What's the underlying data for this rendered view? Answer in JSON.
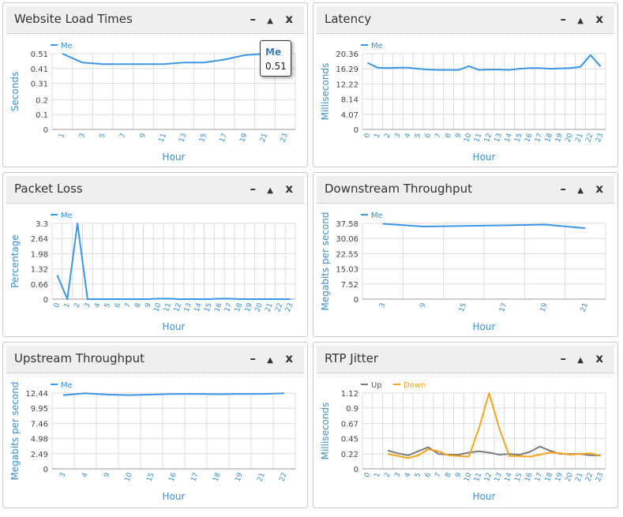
{
  "controls": {
    "minimize": "–",
    "maximize": "▲",
    "close": "x"
  },
  "colors": {
    "line": "#3c96e6",
    "text": "#3c8fcf",
    "grid": "#dcdcdc",
    "up": "#7c7c7c",
    "down": "#f5a41c"
  },
  "tooltip": {
    "series": "Me",
    "value": "0.51"
  },
  "chart_data": [
    {
      "type": "line",
      "title": "Website Load Times",
      "xlabel": "Hour",
      "ylabel": "Seconds",
      "legend": "top-left",
      "yticks": [
        "0.51",
        "0.41",
        "0.31",
        "0.2",
        "0.1",
        "0"
      ],
      "ylim": [
        0,
        0.51
      ],
      "xcats": [
        "1",
        "3",
        "5",
        "7",
        "9",
        "11",
        "13",
        "15",
        "17",
        "19",
        "21",
        "23"
      ],
      "series": [
        {
          "name": "Me",
          "color": "#3c96e6",
          "values": [
            0.51,
            0.45,
            0.44,
            0.44,
            0.44,
            0.44,
            0.45,
            0.45,
            0.47,
            0.5,
            0.51,
            0.51
          ]
        }
      ]
    },
    {
      "type": "line",
      "title": "Latency",
      "xlabel": "Hour",
      "ylabel": "Milliseconds",
      "legend": "top-left",
      "yticks": [
        "20.36",
        "16.29",
        "12.22",
        "8.14",
        "4.07",
        "0"
      ],
      "ylim": [
        0,
        20.36
      ],
      "xcats": [
        "0",
        "1",
        "2",
        "3",
        "4",
        "5",
        "6",
        "7",
        "8",
        "9",
        "10",
        "11",
        "12",
        "13",
        "14",
        "15",
        "16",
        "17",
        "18",
        "19",
        "20",
        "21",
        "22",
        "23"
      ],
      "series": [
        {
          "name": "Me",
          "color": "#3c96e6",
          "values": [
            17.9,
            16.6,
            16.5,
            16.6,
            16.6,
            16.3,
            16.1,
            16.0,
            16.0,
            16.0,
            17.0,
            16.0,
            16.1,
            16.1,
            16.0,
            16.3,
            16.5,
            16.5,
            16.3,
            16.4,
            16.5,
            16.8,
            20.0,
            16.9
          ]
        }
      ]
    },
    {
      "type": "line",
      "title": "Packet Loss",
      "xlabel": "Hour",
      "ylabel": "Percentage",
      "legend": "top-left",
      "yticks": [
        "3.3",
        "2.64",
        "1.98",
        "1.32",
        "0.66",
        "0"
      ],
      "ylim": [
        0,
        3.3
      ],
      "xcats": [
        "0",
        "1",
        "2",
        "3",
        "4",
        "5",
        "6",
        "7",
        "8",
        "9",
        "10",
        "11",
        "12",
        "13",
        "14",
        "15",
        "16",
        "17",
        "18",
        "19",
        "20",
        "21",
        "22",
        "23"
      ],
      "series": [
        {
          "name": "Me",
          "color": "#3c96e6",
          "values": [
            1.05,
            0,
            3.3,
            0,
            0,
            0,
            0,
            0,
            0,
            0,
            0.02,
            0.02,
            0,
            0,
            0,
            0,
            0.02,
            0.02,
            0,
            0,
            0,
            0,
            0,
            0
          ]
        }
      ]
    },
    {
      "type": "line",
      "title": "Downstream Throughput",
      "xlabel": "Hour",
      "ylabel": "Megabits per second",
      "legend": "top-left",
      "yticks": [
        "37.58",
        "30.06",
        "22.55",
        "15.03",
        "7.52",
        "0"
      ],
      "ylim": [
        0,
        37.58
      ],
      "xcats": [
        "3",
        "9",
        "15",
        "17",
        "19",
        "21"
      ],
      "series": [
        {
          "name": "Me",
          "color": "#3c96e6",
          "values": [
            37.4,
            36.0,
            36.3,
            36.6,
            37.0,
            35.2
          ]
        }
      ]
    },
    {
      "type": "line",
      "title": "Upstream Throughput",
      "xlabel": "Hour",
      "ylabel": "Megabits per second",
      "legend": "top-left",
      "yticks": [
        "12.44",
        "9.95",
        "7.46",
        "4.98",
        "2.49",
        "0"
      ],
      "ylim": [
        0,
        12.44
      ],
      "xcats": [
        "3",
        "4",
        "9",
        "10",
        "15",
        "16",
        "17",
        "18",
        "19",
        "21",
        "22"
      ],
      "series": [
        {
          "name": "Me",
          "color": "#3c96e6",
          "values": [
            12.1,
            12.4,
            12.2,
            12.1,
            12.2,
            12.3,
            12.3,
            12.25,
            12.3,
            12.3,
            12.4
          ]
        }
      ]
    },
    {
      "type": "line",
      "title": "RTP Jitter",
      "xlabel": "Hour",
      "ylabel": "Milliseconds",
      "legend": "top-left",
      "yticks": [
        "1.12",
        "0.9",
        "0.67",
        "0.45",
        "0.22",
        "0"
      ],
      "ylim": [
        0,
        1.12
      ],
      "xcats": [
        "0",
        "1",
        "2",
        "3",
        "4",
        "5",
        "6",
        "7",
        "8",
        "9",
        "10",
        "11",
        "12",
        "13",
        "14",
        "15",
        "16",
        "17",
        "18",
        "19",
        "20",
        "21",
        "22",
        "23"
      ],
      "series": [
        {
          "name": "Up",
          "color": "#7c7c7c",
          "start": 2,
          "values": [
            0.27,
            0.23,
            0.2,
            0.26,
            0.32,
            0.22,
            0.21,
            0.21,
            0.24,
            0.26,
            0.24,
            0.21,
            0.22,
            0.21,
            0.25,
            0.33,
            0.27,
            0.22,
            0.22,
            0.22,
            0.2,
            0.2
          ]
        },
        {
          "name": "Down",
          "color": "#f5a41c",
          "start": 2,
          "values": [
            0.22,
            0.19,
            0.16,
            0.2,
            0.29,
            0.26,
            0.2,
            0.19,
            0.18,
            0.6,
            1.12,
            0.6,
            0.19,
            0.19,
            0.18,
            0.21,
            0.24,
            0.23,
            0.21,
            0.22,
            0.23,
            0.19
          ]
        }
      ]
    }
  ]
}
